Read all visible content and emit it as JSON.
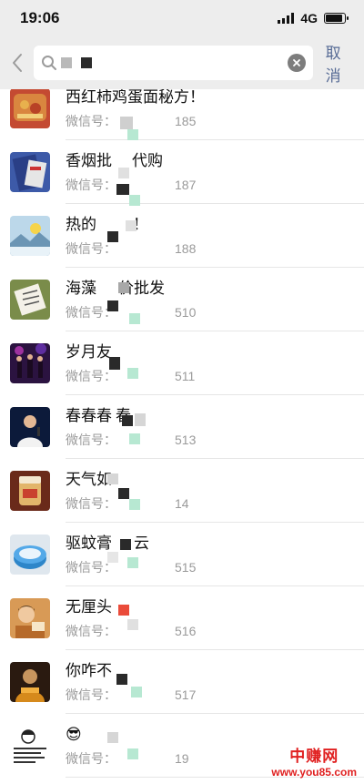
{
  "status": {
    "time": "19:06",
    "network": "4G"
  },
  "search": {
    "query": "",
    "cancel_label": "取消"
  },
  "results": [
    {
      "name": "西红柿鸡蛋面秘方！",
      "wechat": "微信号：",
      "id_suffix": "185"
    },
    {
      "name": "香烟批",
      "name_tail": "代购",
      "wechat": "微信号：",
      "id_suffix": "187"
    },
    {
      "name": "热的",
      "name_tail": "！",
      "wechat": "微信号：",
      "id_suffix": "188"
    },
    {
      "name": "海藻",
      "name_tail": "价批发",
      "wechat": "微信号：",
      "id_suffix": "510"
    },
    {
      "name": "岁月友",
      "name_tail": "",
      "wechat": "微信号：",
      "id_suffix": "511"
    },
    {
      "name": "春春春",
      "name_tail": "春",
      "wechat": "微信号：",
      "id_suffix": "513"
    },
    {
      "name": "天气如",
      "name_tail": "",
      "wechat": "微信号：",
      "id_suffix": "14"
    },
    {
      "name": "驱蚊膏",
      "name_tail": "云",
      "wechat": "微信号：",
      "id_suffix": "515"
    },
    {
      "name": "无厘头",
      "name_tail": "",
      "wechat": "微信号：",
      "id_suffix": "516"
    },
    {
      "name": "你咋不",
      "name_tail": "",
      "wechat": "微信号：",
      "id_suffix": "517"
    },
    {
      "name": "😎",
      "name_tail": "",
      "wechat": "微信号：",
      "id_suffix": "19"
    }
  ],
  "watermark": {
    "title": "中赚网",
    "url": "www.you85.com"
  },
  "colors": {
    "nav_bg": "#ededed",
    "link": "#576b95",
    "watermark": "#e02020",
    "censor_green": "#b7e8d2"
  }
}
